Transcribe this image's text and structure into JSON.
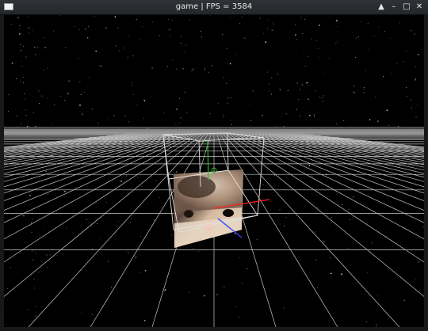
{
  "window": {
    "title": "game | FPS = 3584",
    "controls": {
      "minimize": "▲",
      "restore": "–",
      "maximize": "□",
      "close": "✕"
    }
  },
  "scene": {
    "background_color": "#000000",
    "grid_color": "#bfbfbf",
    "texture_colors": [
      "#e8d4bf",
      "#3a2a22",
      "#c9a88a",
      "#dcc4aa"
    ],
    "axis_colors": {
      "x": "#ff2020",
      "y": "#20c020",
      "z": "#3040ff"
    }
  }
}
